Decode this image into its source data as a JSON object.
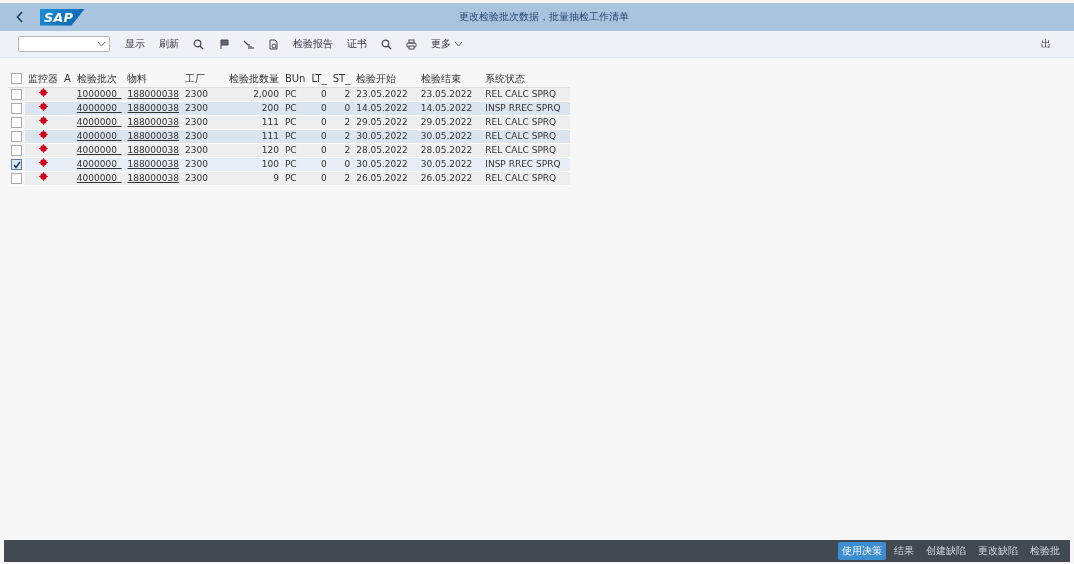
{
  "header": {
    "logo": "SAP",
    "title": "更改检验批次数据，批量抽检工作清单"
  },
  "toolbar": {
    "items": [
      {
        "kind": "text",
        "label": "显示"
      },
      {
        "kind": "text",
        "label": "刷新"
      },
      {
        "kind": "icon"
      },
      {
        "kind": "icon"
      },
      {
        "kind": "icon"
      },
      {
        "kind": "icon"
      },
      {
        "kind": "text",
        "label": "检验报告"
      },
      {
        "kind": "text",
        "label": "证书"
      },
      {
        "kind": "icon"
      },
      {
        "kind": "icon"
      },
      {
        "kind": "menu",
        "label": "更多"
      }
    ],
    "exit": "出"
  },
  "table": {
    "all_selected": false,
    "columns": [
      "监控器",
      "A",
      "检验批次",
      "物料",
      "工厂",
      "检验批数量",
      "BUn",
      "LT_",
      "ST_",
      "检验开始",
      "检验结束",
      "系统状态"
    ],
    "rows": [
      {
        "selected": false,
        "highlighted": false,
        "lot": "1000000_",
        "material": "188000038",
        "plant": "2300",
        "qty": "2,000",
        "bun": "PC",
        "lt": "0",
        "st": "2",
        "start": "23.05.2022",
        "end": "23.05.2022",
        "status": "REL  CALC SPRQ"
      },
      {
        "selected": false,
        "highlighted": true,
        "lot": "4000000_",
        "material": "188000038",
        "plant": "2300",
        "qty": "200",
        "bun": "PC",
        "lt": "0",
        "st": "0",
        "start": "14.05.2022",
        "end": "14.05.2022",
        "status": "INSP RREC SPRQ"
      },
      {
        "selected": false,
        "highlighted": false,
        "lot": "4000000_",
        "material": "188000038",
        "plant": "2300",
        "qty": "111",
        "bun": "PC",
        "lt": "0",
        "st": "2",
        "start": "29.05.2022",
        "end": "29.05.2022",
        "status": "REL  CALC SPRQ"
      },
      {
        "selected": false,
        "highlighted": true,
        "lot": "4000000_",
        "material": "188000038",
        "plant": "2300",
        "qty": "111",
        "bun": "PC",
        "lt": "0",
        "st": "2",
        "start": "30.05.2022",
        "end": "30.05.2022",
        "status": "REL  CALC SPRQ"
      },
      {
        "selected": false,
        "highlighted": false,
        "lot": "4000000_",
        "material": "188000038",
        "plant": "2300",
        "qty": "120",
        "bun": "PC",
        "lt": "0",
        "st": "2",
        "start": "28.05.2022",
        "end": "28.05.2022",
        "status": "REL  CALC SPRQ"
      },
      {
        "selected": true,
        "highlighted": false,
        "lot": "4000000_",
        "material": "188000038",
        "plant": "2300",
        "qty": "100",
        "bun": "PC",
        "lt": "0",
        "st": "0",
        "start": "30.05.2022",
        "end": "30.05.2022",
        "status": "INSP RREC SPRQ"
      },
      {
        "selected": false,
        "highlighted": false,
        "lot": "4000000_",
        "material": "188000038",
        "plant": "2300",
        "qty": "9",
        "bun": "PC",
        "lt": "0",
        "st": "2",
        "start": "26.05.2022",
        "end": "26.05.2022",
        "status": "REL  CALC SPRQ"
      }
    ]
  },
  "footer": {
    "buttons": [
      {
        "label": "使用决策",
        "primary": true
      },
      {
        "label": "结果",
        "primary": false
      },
      {
        "label": "创建缺陷",
        "primary": false
      },
      {
        "label": "更改缺陷",
        "primary": false
      },
      {
        "label": "检验批",
        "primary": false
      }
    ]
  }
}
